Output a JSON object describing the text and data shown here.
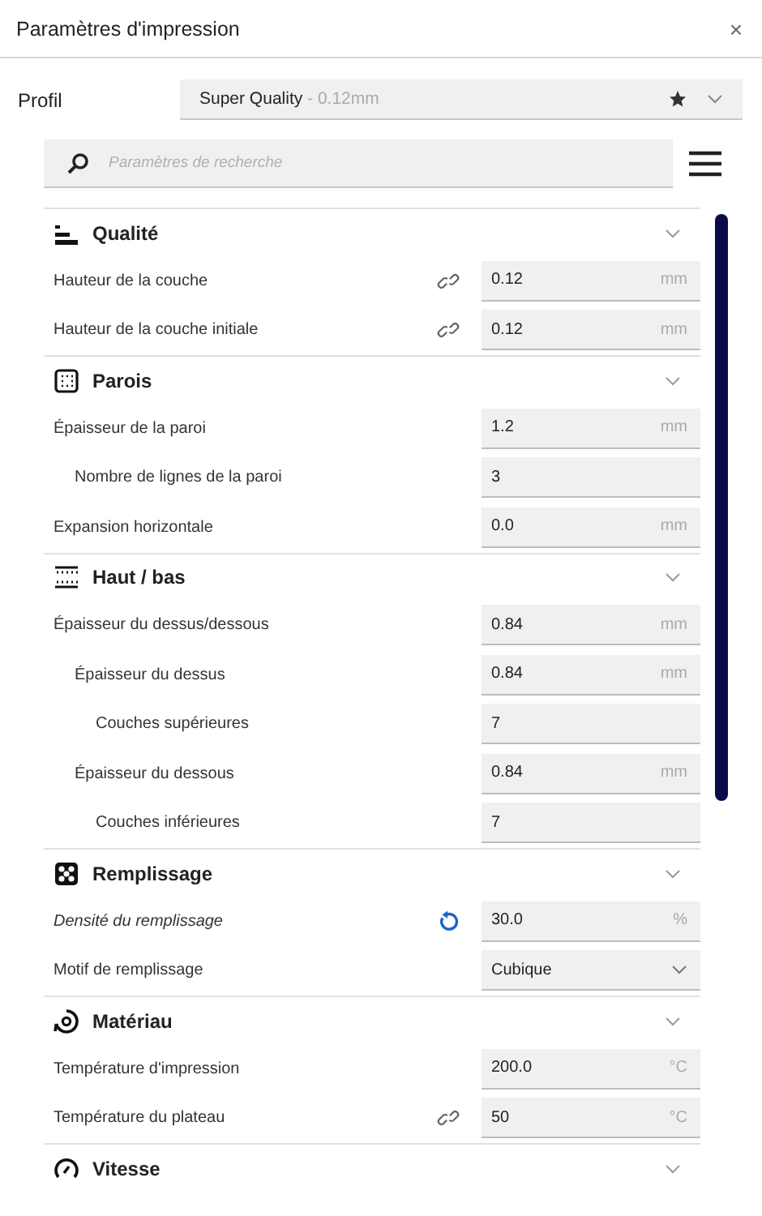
{
  "window": {
    "title": "Paramètres d'impression",
    "close": "×"
  },
  "profile": {
    "label": "Profil",
    "name": "Super Quality",
    "detail": " - 0.12mm",
    "favorite": true
  },
  "search": {
    "placeholder": "Paramètres de recherche"
  },
  "sections": [
    {
      "title": "Qualité",
      "kind": "quality",
      "expanded": true,
      "settings": [
        {
          "label": "Hauteur de la couche",
          "kind": "field",
          "value": "0.12",
          "unit": "mm",
          "indicator": {
            "kind": "linked"
          },
          "user_set": false
        },
        {
          "label": "Hauteur de la couche initiale",
          "kind": "field",
          "value": "0.12",
          "unit": "mm",
          "indicator": {
            "kind": "linked"
          },
          "user_set": false
        }
      ]
    },
    {
      "title": "Parois",
      "kind": "walls",
      "expanded": true,
      "settings": [
        {
          "label": "Épaisseur de la paroi",
          "kind": "field",
          "value": "1.2",
          "unit": "mm",
          "user_set": false,
          "children": [
            {
              "label": "Nombre de lignes de la paroi",
              "kind": "field",
              "value": "3",
              "user_set": false
            }
          ]
        },
        {
          "label": "Expansion horizontale",
          "kind": "field",
          "value": "0.0",
          "unit": "mm",
          "user_set": false
        }
      ]
    },
    {
      "title": "Haut / bas",
      "kind": "topbottom",
      "expanded": true,
      "settings": [
        {
          "label": "Épaisseur du dessus/dessous",
          "kind": "field",
          "value": "0.84",
          "unit": "mm",
          "user_set": false,
          "children": [
            {
              "label": "Épaisseur du dessus",
              "kind": "field",
              "value": "0.84",
              "unit": "mm",
              "user_set": false,
              "children": [
                {
                  "label": "Couches supérieures",
                  "kind": "field",
                  "value": "7",
                  "user_set": false
                }
              ]
            },
            {
              "label": "Épaisseur du dessous",
              "kind": "field",
              "value": "0.84",
              "unit": "mm",
              "user_set": false,
              "children": [
                {
                  "label": "Couches inférieures",
                  "kind": "field",
                  "value": "7",
                  "user_set": false
                }
              ]
            }
          ]
        }
      ]
    },
    {
      "title": "Remplissage",
      "kind": "infill",
      "expanded": true,
      "settings": [
        {
          "label": "Densité du remplissage",
          "kind": "field",
          "value": "30.0",
          "unit": "%",
          "indicator": {
            "kind": "reset"
          },
          "user_set": true
        },
        {
          "label": "Motif de remplissage",
          "kind": "select",
          "value": "Cubique",
          "user_set": false
        }
      ]
    },
    {
      "title": "Matériau",
      "kind": "material",
      "expanded": true,
      "settings": [
        {
          "label": "Température d'impression",
          "kind": "field",
          "value": "200.0",
          "unit": "°C",
          "user_set": false
        },
        {
          "label": "Température du plateau",
          "kind": "field",
          "value": "50",
          "unit": "°C",
          "indicator": {
            "kind": "linked"
          },
          "user_set": false
        }
      ]
    },
    {
      "title": "Vitesse",
      "kind": "speed",
      "expanded": true
    }
  ]
}
